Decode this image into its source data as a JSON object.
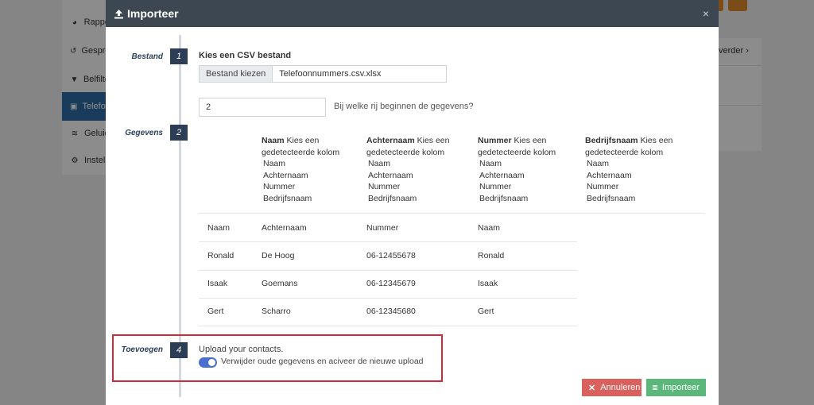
{
  "background": {
    "sidebar_items": [
      {
        "label": "Rappo",
        "icon": "pie-chart-icon"
      },
      {
        "label": "Gespre",
        "icon": "history-icon"
      },
      {
        "label": "Belfilte",
        "icon": "filter-icon"
      },
      {
        "label": "Telefoo",
        "icon": "phonebook-icon",
        "active": true
      },
      {
        "label": "Geluid",
        "icon": "audio-wave-icon"
      },
      {
        "label": "Instelli",
        "icon": "gear-icon"
      }
    ],
    "right_panel_link": "verder"
  },
  "modal": {
    "title": "Importeer",
    "close": "×",
    "steps": [
      {
        "label": "Bestand",
        "number": "1"
      },
      {
        "label": "Gegevens",
        "number": "2"
      },
      {
        "label": "Toevoegen",
        "number": "4"
      }
    ],
    "file_section": {
      "title": "Kies een CSV bestand",
      "button_label": "Bestand kiezen",
      "file_name": "Telefoonnummers.csv.xlsx"
    },
    "start_row": {
      "value": "2",
      "question": "Bij welke rij beginnen de gegevens?"
    },
    "column_mappings": [
      {
        "name": "Naam",
        "hint": "Kies een gedetecteerde kolom",
        "options": [
          "Naam",
          "Achternaam",
          "Nummer",
          "Bedrijfsnaam"
        ]
      },
      {
        "name": "Achternaam",
        "hint": "Kies een gedetecteerde kolom",
        "options": [
          "Naam",
          "Achternaam",
          "Nummer",
          "Bedrijfsnaam"
        ]
      },
      {
        "name": "Nummer",
        "hint": "Kies een gedetecteerde kolom",
        "options": [
          "Naam",
          "Achternaam",
          "Nummer",
          "Bedrijfsnaam"
        ]
      },
      {
        "name": "Bedrijfsnaam",
        "hint": "Kies een gedetecteerde kolom",
        "options": [
          "Naam",
          "Achternaam",
          "Nummer",
          "Bedrijfsnaam"
        ]
      }
    ],
    "preview_rows": [
      [
        "Naam",
        "Achternaam",
        "Nummer",
        "Naam"
      ],
      [
        "Ronald",
        "De Hoog",
        "06-12455678",
        "Ronald"
      ],
      [
        "Isaak",
        "Goemans",
        "06-12345679",
        "Isaak"
      ],
      [
        "Gert",
        "Scharro",
        "06-12345680",
        "Gert"
      ]
    ],
    "add_section": {
      "text": "Upload your contacts.",
      "toggle_label": "Verwijder oude gegevens en aciveer de nieuwe upload",
      "toggle_on": true
    },
    "buttons": {
      "cancel": "Annuleren",
      "import": "Importeer"
    }
  },
  "colors": {
    "header": "#3d4752",
    "step_badge": "#2c3e55",
    "cancel": "#d9605c",
    "import": "#5cb87a",
    "highlight": "#d0293a",
    "toggle": "#4a6fd1"
  }
}
